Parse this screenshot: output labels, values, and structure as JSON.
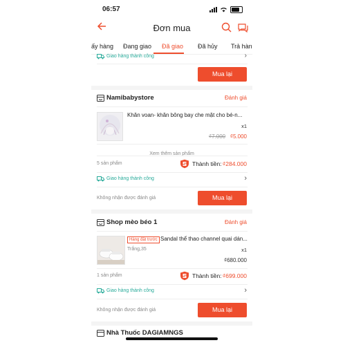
{
  "status_bar": {
    "time": "06:57"
  },
  "header": {
    "title": "Đơn mua"
  },
  "tabs": [
    {
      "label": "ấy hàng"
    },
    {
      "label": "Đang giao"
    },
    {
      "label": "Đã giao"
    },
    {
      "label": "Đã hủy"
    },
    {
      "label": "Trả hàng"
    }
  ],
  "order0": {
    "ship_status": "Giao hàng thành công",
    "rebuy_label": "Mua lại"
  },
  "order1": {
    "shop": "Namibabystore",
    "rate_label": "Đánh giá",
    "product": "Khăn voan- khăn bông bay che mặt cho bé-n...",
    "qty": "x1",
    "old_price": "₫7.000",
    "price": "₫5.000",
    "see_more": "Xem thêm sản phẩm",
    "count": "5 sản phẩm",
    "total_label": "Thành tiền:",
    "total": "₫284.000",
    "ship_status": "Giao hàng thành công",
    "no_rating": "Không nhận được đánh giá",
    "rebuy_label": "Mua lại"
  },
  "order2": {
    "shop": "Shop mèo béo 1",
    "rate_label": "Đánh giá",
    "badge": "Hàng đặt trước",
    "product": "Sandal thể thao channel quai dán...",
    "variant": "Trắng,35",
    "qty": "x1",
    "price": "₫680.000",
    "count": "1 sản phẩm",
    "total_label": "Thành tiền:",
    "total": "₫699.000",
    "ship_status": "Giao hàng thành công",
    "no_rating": "Không nhận được đánh giá",
    "rebuy_label": "Mua lại"
  },
  "order3": {
    "shop": "Nhà Thuốc DAGIAMNGS"
  },
  "colors": {
    "accent": "#ee4d2d",
    "success": "#26aa99",
    "bg_gray": "#f4f4f4"
  }
}
